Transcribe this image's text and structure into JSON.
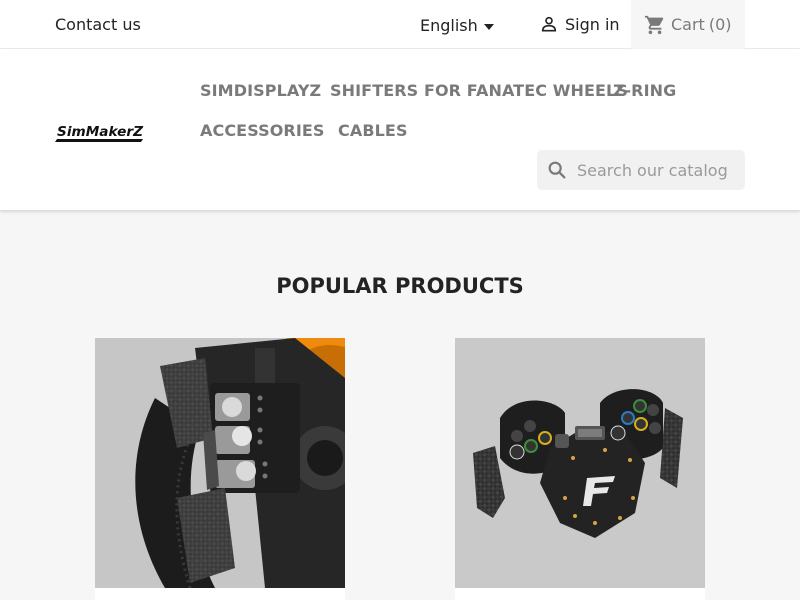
{
  "topbar": {
    "contact": "Contact us",
    "language": "English",
    "signin": "Sign in",
    "cart_label": "Cart",
    "cart_count": "(0)"
  },
  "header": {
    "logo_text": "SimMakerZ",
    "menu": [
      "SIMDISPLAYZ",
      "SHIFTERS FOR FANATEC WHEELS",
      "Z-RING",
      "ACCESSORIES",
      "CABLES"
    ],
    "search_placeholder": "Search our catalog"
  },
  "main": {
    "section_title": "POPULAR PRODUCTS"
  },
  "colors": {
    "accent_orange": "#f08a0c",
    "carbon": "#2b2b2b",
    "page_bg": "#f6f6f6"
  }
}
